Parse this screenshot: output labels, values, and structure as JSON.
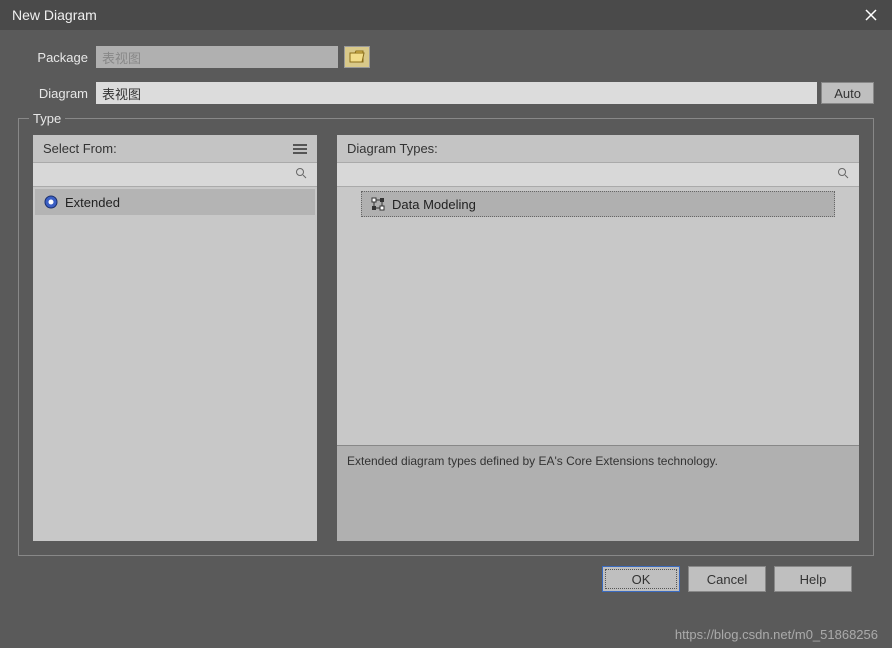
{
  "window": {
    "title": "New Diagram"
  },
  "form": {
    "package_label": "Package",
    "package_value": "表视图",
    "diagram_label": "Diagram",
    "diagram_value": "表视图",
    "auto_label": "Auto"
  },
  "groupbox": {
    "legend": "Type",
    "left": {
      "header": "Select From:",
      "items": [
        {
          "label": "Extended",
          "icon": "extended-icon"
        }
      ]
    },
    "right": {
      "header": "Diagram Types:",
      "items": [
        {
          "label": "Data Modeling",
          "icon": "data-modeling-icon"
        }
      ],
      "description": "Extended diagram types defined by EA's Core Extensions technology."
    }
  },
  "footer": {
    "ok": "OK",
    "cancel": "Cancel",
    "help": "Help"
  },
  "watermark": "https://blog.csdn.net/m0_51868256"
}
